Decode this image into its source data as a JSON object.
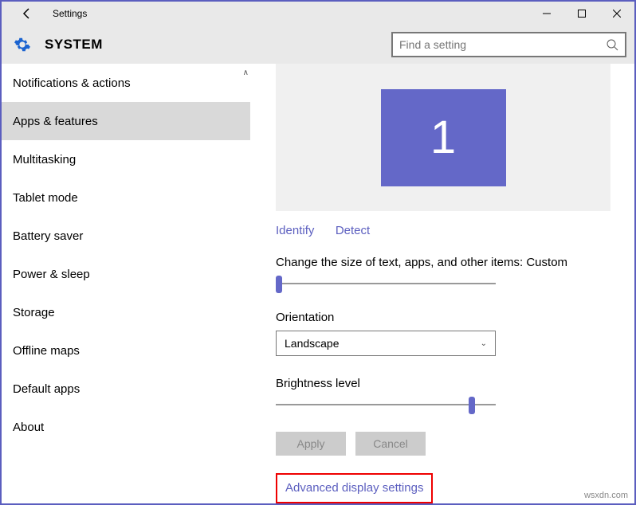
{
  "titlebar": {
    "title": "Settings"
  },
  "header": {
    "title": "SYSTEM"
  },
  "search": {
    "placeholder": "Find a setting"
  },
  "sidebar": {
    "items": [
      {
        "label": "Notifications & actions",
        "selected": false
      },
      {
        "label": "Apps & features",
        "selected": true
      },
      {
        "label": "Multitasking",
        "selected": false
      },
      {
        "label": "Tablet mode",
        "selected": false
      },
      {
        "label": "Battery saver",
        "selected": false
      },
      {
        "label": "Power & sleep",
        "selected": false
      },
      {
        "label": "Storage",
        "selected": false
      },
      {
        "label": "Offline maps",
        "selected": false
      },
      {
        "label": "Default apps",
        "selected": false
      },
      {
        "label": "About",
        "selected": false
      }
    ]
  },
  "display": {
    "monitor_number": "1",
    "identify": "Identify",
    "detect": "Detect",
    "scale_label": "Change the size of text, apps, and other items: Custom",
    "orientation_label": "Orientation",
    "orientation_value": "Landscape",
    "brightness_label": "Brightness level",
    "apply": "Apply",
    "cancel": "Cancel",
    "advanced": "Advanced display settings"
  },
  "watermark": "wsxdn.com"
}
